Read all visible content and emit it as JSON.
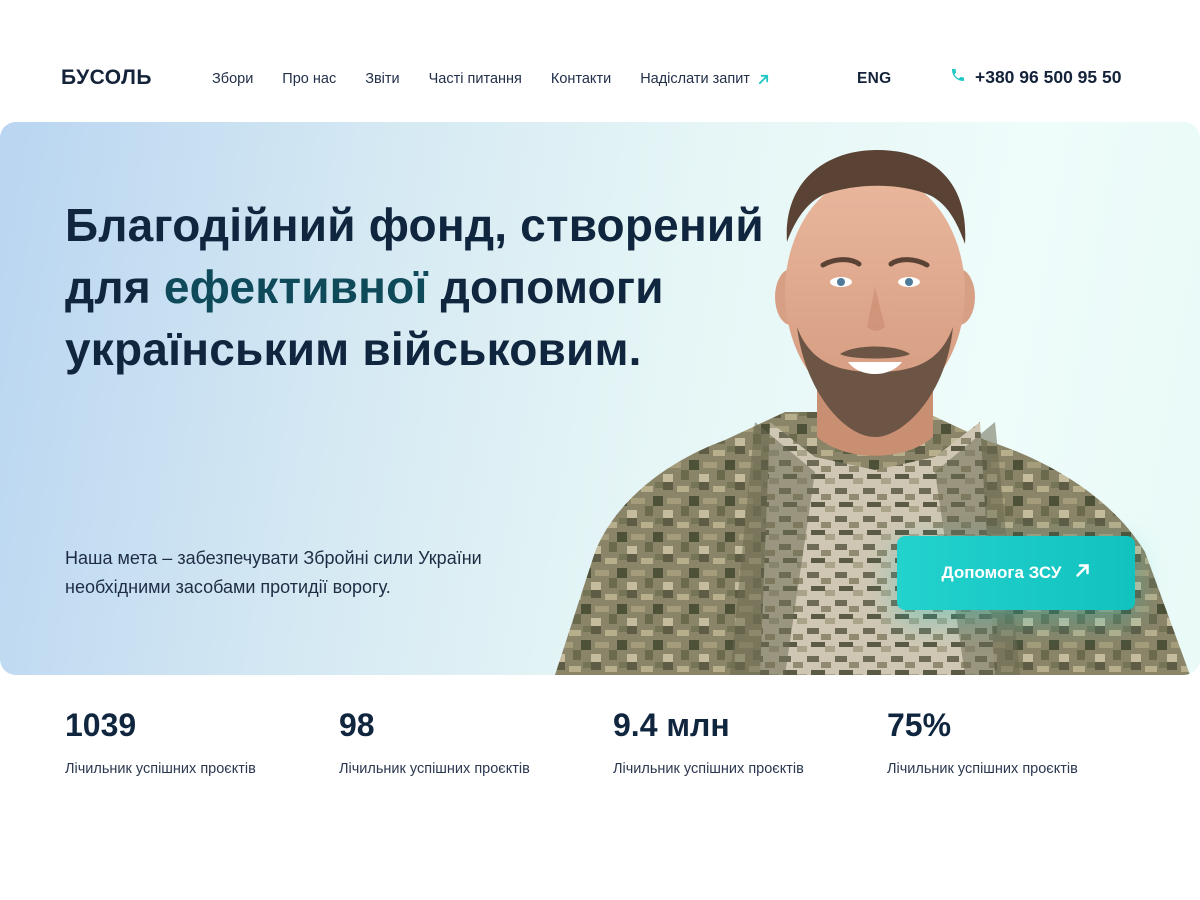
{
  "header": {
    "logo": "БУСОЛЬ",
    "nav": [
      {
        "label": "Збори"
      },
      {
        "label": "Про нас"
      },
      {
        "label": "Звіти"
      },
      {
        "label": "Часті питання"
      },
      {
        "label": "Контакти"
      },
      {
        "label": "Надіслати запит",
        "icon": "arrow-up-right-icon"
      }
    ],
    "lang": "ENG",
    "phone": "+380 96 500 95 50",
    "phone_icon": "phone-icon"
  },
  "hero": {
    "title_part1": "Благодійний фонд, створений для ",
    "title_accent": "ефективної",
    "title_part2": " допомоги українським військовим.",
    "subtitle": "Наша мета – забезпечувати Збройні сили України необхідними засобами протидії ворогу.",
    "cta_label": "Допомога ЗСУ",
    "cta_icon": "arrow-up-right-icon"
  },
  "stats": [
    {
      "value": "1039",
      "label": "Лічильник успішних проєктів"
    },
    {
      "value": "98",
      "label": "Лічильник успішних проєктів"
    },
    {
      "value": "9.4 млн",
      "label": "Лічильник успішних проєктів"
    },
    {
      "value": "75%",
      "label": "Лічильник успішних проєктів"
    }
  ],
  "colors": {
    "accent": "#1ec8c4",
    "text_dark": "#10253e",
    "title_accent": "#0f4a5a"
  }
}
